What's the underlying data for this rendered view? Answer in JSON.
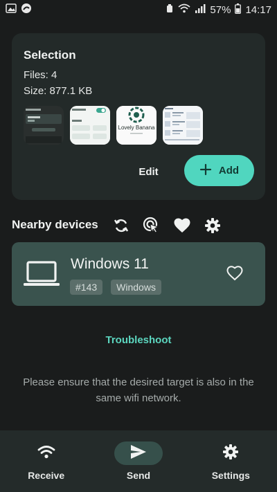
{
  "status_bar": {
    "battery": "57%",
    "time": "14:17"
  },
  "selection": {
    "title": "Selection",
    "files": "Files: 4",
    "size": "Size: 877.1 KB",
    "thumbnails": [
      {
        "icon": "screenshot-thumbnail",
        "label": ""
      },
      {
        "icon": "settings-screenshot-thumbnail",
        "label": ""
      },
      {
        "icon": "logo-thumbnail",
        "label": "Lovely Banana"
      },
      {
        "icon": "document-thumbnail",
        "label": ""
      }
    ],
    "edit_label": "Edit",
    "add_label": "Add"
  },
  "nearby": {
    "title": "Nearby devices",
    "icons": [
      "refresh-icon",
      "touch-target-icon",
      "favorite-icon",
      "settings-gear-icon"
    ]
  },
  "device": {
    "name": "Windows 11",
    "tag_id": "#143",
    "tag_os": "Windows",
    "icon": "laptop-icon"
  },
  "troubleshoot_label": "Troubleshoot",
  "hint_text": "Please ensure that the desired target is also in the same wifi network.",
  "bottom_nav": {
    "items": [
      {
        "label": "Receive",
        "icon": "wifi-icon",
        "active": false
      },
      {
        "label": "Send",
        "icon": "send-icon",
        "active": true
      },
      {
        "label": "Settings",
        "icon": "gear-icon",
        "active": false
      }
    ]
  },
  "colors": {
    "background": "#1a1c1c",
    "card": "#232a29",
    "accent": "#50d6bf",
    "device_card": "#3a534e",
    "nav_bar": "#242b2a"
  }
}
